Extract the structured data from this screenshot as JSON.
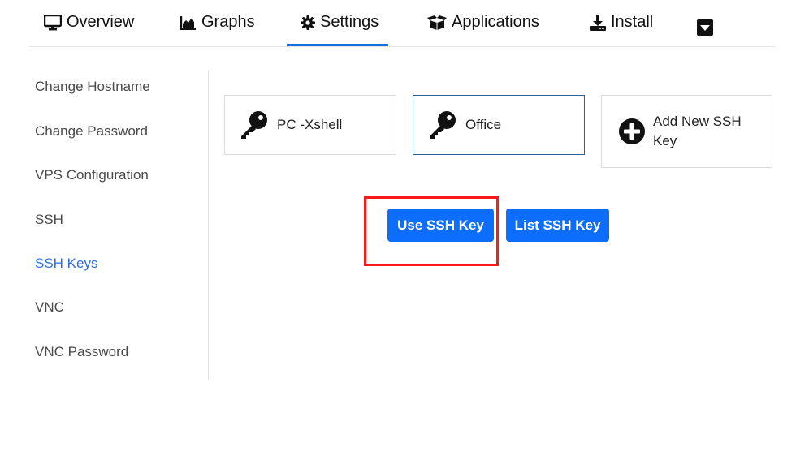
{
  "tabs": [
    {
      "label": "Overview",
      "icon": "monitor-icon"
    },
    {
      "label": "Graphs",
      "icon": "area-chart-icon"
    },
    {
      "label": "Settings",
      "icon": "gear-icon"
    },
    {
      "label": "Applications",
      "icon": "box-icon"
    },
    {
      "label": "Install",
      "icon": "download-icon"
    }
  ],
  "active_tab": "Settings",
  "sidebar": {
    "items": [
      {
        "label": "Change Hostname"
      },
      {
        "label": "Change Password"
      },
      {
        "label": "VPS Configuration"
      },
      {
        "label": "SSH"
      },
      {
        "label": "SSH Keys"
      },
      {
        "label": "VNC"
      },
      {
        "label": "VNC Password"
      }
    ],
    "active": "SSH Keys"
  },
  "keys": {
    "items": [
      {
        "label": "PC -Xshell",
        "icon": "key-icon"
      },
      {
        "label": "Office",
        "icon": "key-icon"
      }
    ],
    "selected": "Office",
    "add_new": {
      "line1": "Add New SSH",
      "line2": "Key",
      "icon": "plus-circle-icon"
    }
  },
  "actions": {
    "use_label": "Use SSH Key",
    "list_label": "List SSH Key"
  },
  "colors": {
    "accent": "#0d6efd",
    "active_link": "#2b6de6",
    "highlight": "#ff1a1a"
  }
}
